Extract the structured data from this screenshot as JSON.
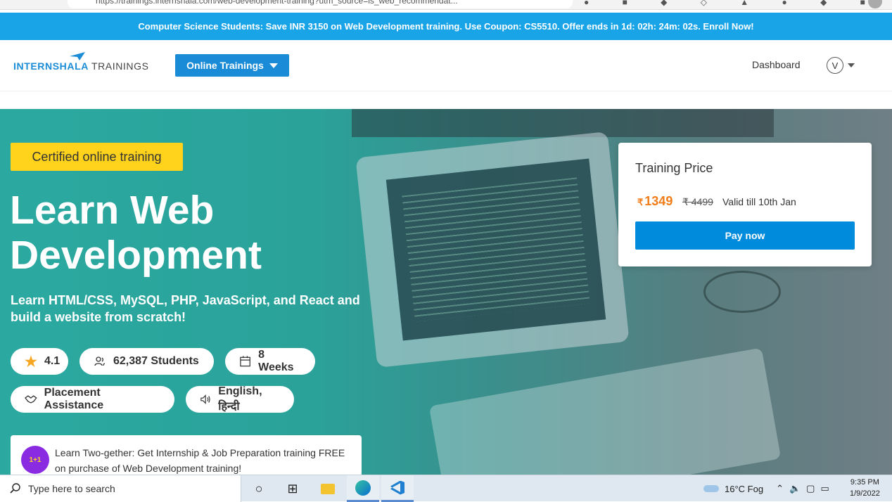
{
  "browser": {
    "url": "https://trainings.internshala.com/web-development-training?utm_source=is_web_recommendat..."
  },
  "promo": {
    "text": "Computer Science Students: Save INR 3150 on Web Development training. Use Coupon: CS5510. Offer ends in 1d: 02h: 24m: 02s. Enroll Now!"
  },
  "header": {
    "logo_main": "INTERNSHALA",
    "logo_sub": "TRAININGS",
    "online_trainings": "Online Trainings",
    "dashboard": "Dashboard",
    "user_initial": "V"
  },
  "hero": {
    "badge": "Certified online training",
    "title": "Learn Web Development",
    "subtitle": "Learn HTML/CSS, MySQL, PHP, JavaScript, and React and build a website from scratch!",
    "rating": "4.1",
    "students": "62,387 Students",
    "duration": "8 Weeks",
    "placement": "Placement Assistance",
    "language": "English, हिन्दी",
    "twogether_badge": "1+1",
    "twogether_title": "Learn Two-gether:",
    "twogether_text": "Get Internship & Job Preparation training FREE on purchase of Web Development training!"
  },
  "price": {
    "title": "Training Price",
    "currency": "₹",
    "current": "1349",
    "original": "₹ 4499",
    "valid": "Valid till 10th Jan",
    "pay_button": "Pay now"
  },
  "taskbar": {
    "search_placeholder": "Type here to search",
    "weather": "16°C  Fog",
    "time": "9:35 PM",
    "date": "1/9/2022"
  },
  "colors": {
    "promo_bg": "#1aa4e8",
    "brand_blue": "#1a8bd6",
    "badge_yellow": "#ffd21c",
    "price_orange": "#f07c1a",
    "pay_blue": "#008bdc"
  }
}
